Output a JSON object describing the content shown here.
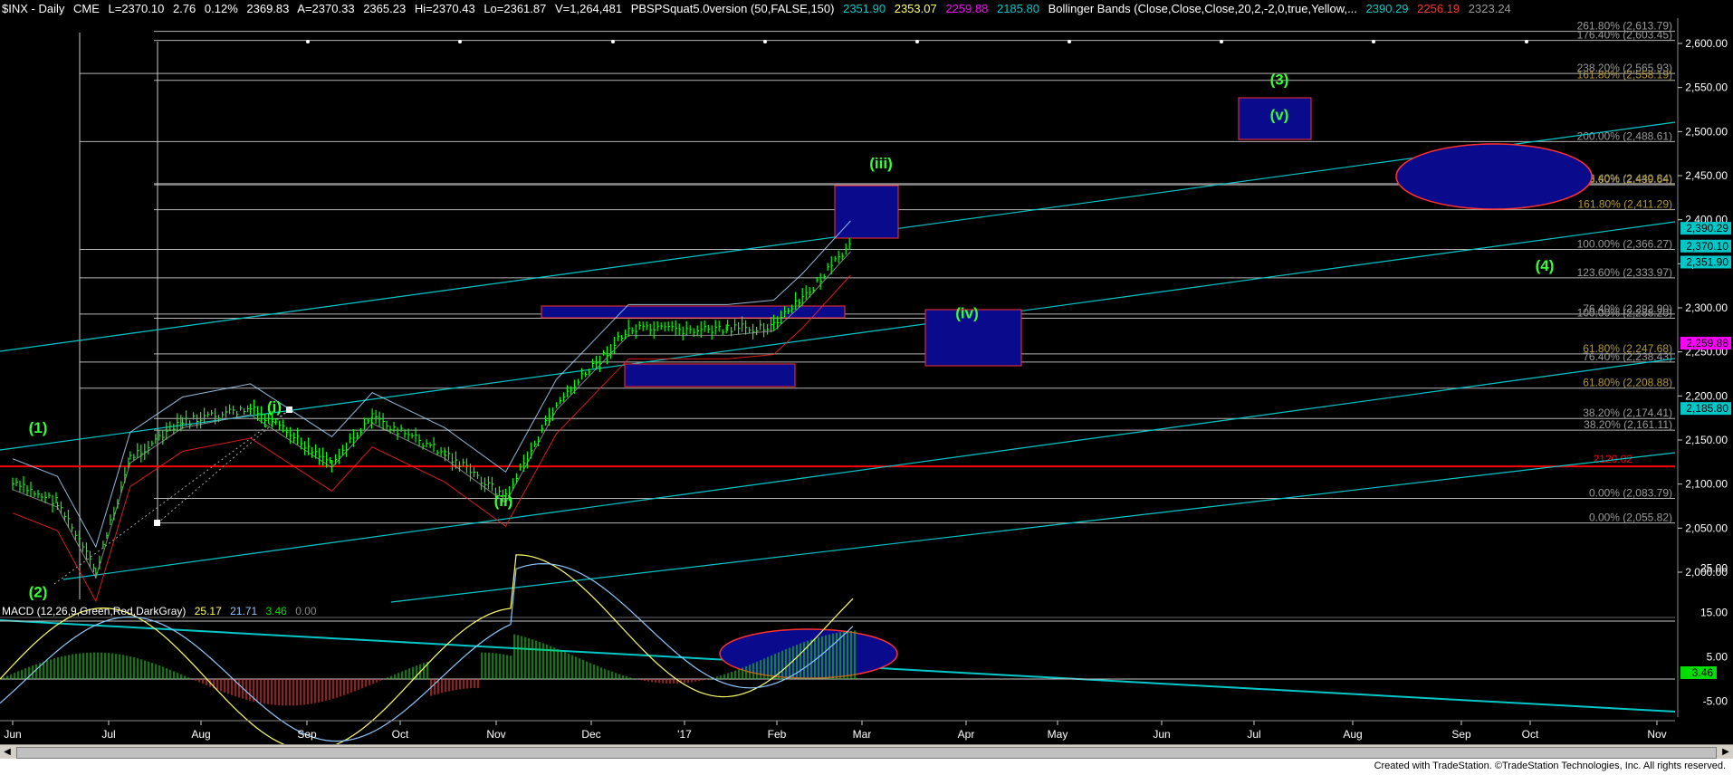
{
  "header": {
    "symbol": "$INX - Daily",
    "exchange": "CME",
    "last": "L=2370.10",
    "change": "2.76",
    "change_pct": "0.12%",
    "bid": "2369.83",
    "ask": "A=2370.33",
    "open": "2365.23",
    "high": "Hi=2370.43",
    "low": "Lo=2361.87",
    "volume": "V=1,264,481",
    "indicator": "PBSPSquat5.0version (50,FALSE,150)",
    "ind_v1": "2351.90",
    "ind_v2": "2353.07",
    "ind_v3": "2259.88",
    "ind_v4": "2185.80",
    "bb_label": "Bollinger Bands (Close,Close,Close,20,2,-2,0,true,Yellow,...",
    "bb_v1": "2390.29",
    "bb_v2": "2256.19",
    "bb_v3": "2323.24"
  },
  "colors": {
    "background": "#000000",
    "price_bar": "#00ff00",
    "channel": "#00c8c8",
    "fib_line": "#c8c8c8",
    "fib_text_gray": "#9a9a9a",
    "fib_text_olive": "#b59a30",
    "red_line": "#ff0000",
    "box_fill": "#0a0a8c",
    "box_stroke": "#ff3030",
    "wave_label": "#33ff33",
    "macd_line": "#ffff66",
    "signal_line": "#8fc8ff",
    "histogram": "#00dd00",
    "histogram_neg": "#ff3030",
    "axis_box_cyan": "#00c8c8",
    "axis_box_magenta": "#ff00ff"
  },
  "price_axis": {
    "ticks": [
      "2,600.00",
      "2,550.00",
      "2,500.00",
      "2,450.00",
      "2,400.00",
      "2,350.00",
      "2,300.00",
      "2,250.00",
      "2,200.00",
      "2,150.00",
      "2,100.00",
      "2,050.00",
      "2,000.00"
    ],
    "highlight_values": [
      {
        "label": "2,390.29",
        "value": 2390.29,
        "color": "#00c8c8"
      },
      {
        "label": "2,370.10",
        "value": 2370.1,
        "color": "#00c8c8"
      },
      {
        "label": "2,351.90",
        "value": 2351.9,
        "color": "#00c8c8"
      },
      {
        "label": "2,259.88",
        "value": 2259.88,
        "color": "#ff00ff"
      },
      {
        "label": "2,185.80",
        "value": 2185.8,
        "color": "#00c8c8"
      }
    ]
  },
  "macd": {
    "label": "MACD (12,26,9,Green,Red,DarkGray)",
    "v1": "25.17",
    "v2": "21.71",
    "v3": "3.46",
    "v4": "0.00",
    "ticks": [
      "25.00",
      "15.00",
      "5.00",
      "-5.00"
    ],
    "current_box": "3.46"
  },
  "time_axis": [
    "Jun",
    "Jul",
    "Aug",
    "Sep",
    "Oct",
    "Nov",
    "Dec",
    "'17",
    "Feb",
    "Mar",
    "Apr",
    "May",
    "Jun",
    "Jul",
    "Aug",
    "Sep",
    "Oct",
    "Nov"
  ],
  "fib_levels": [
    {
      "label": "261.80% (2,613.79)",
      "value": 2613.79,
      "color": "#9a9a9a"
    },
    {
      "label": "176.40% (2,603.45)",
      "value": 2603.45,
      "color": "#9a9a9a"
    },
    {
      "label": "238.20% (2,565.93)",
      "value": 2565.93,
      "color": "#9a9a9a"
    },
    {
      "label": "161.80% (2,558.19)",
      "value": 2558.19,
      "color": "#b59a30"
    },
    {
      "label": "200.00% (2,488.61)",
      "value": 2488.61,
      "color": "#9a9a9a"
    },
    {
      "label": "176.40% (2,440.84)",
      "value": 2440.84,
      "color": "#9a9a9a"
    },
    {
      "label": "123.60% (2,439.64)",
      "value": 2439.64,
      "color": "#b59a30"
    },
    {
      "label": "161.80% (2,411.29)",
      "value": 2411.29,
      "color": "#b59a30"
    },
    {
      "label": "100.00% (2,366.27)",
      "value": 2366.27,
      "color": "#9a9a9a"
    },
    {
      "label": "123.60% (2,333.97)",
      "value": 2333.97,
      "color": "#9a9a9a"
    },
    {
      "label": "76.40% (2,292.90)",
      "value": 2292.9,
      "color": "#9a9a9a"
    },
    {
      "label": "100.00% (2,288.20)",
      "value": 2288.2,
      "color": "#9a9a9a"
    },
    {
      "label": "61.80% (2,247.68)",
      "value": 2247.68,
      "color": "#b59a30"
    },
    {
      "label": "76.40% (2,238.43)",
      "value": 2238.43,
      "color": "#9a9a9a"
    },
    {
      "label": "61.80% (2,208.88)",
      "value": 2208.88,
      "color": "#b59a30"
    },
    {
      "label": "38.20% (2,174.41)",
      "value": 2174.41,
      "color": "#9a9a9a"
    },
    {
      "label": "38.20% (2,161.11)",
      "value": 2161.11,
      "color": "#9a9a9a"
    },
    {
      "label": "0.00% (2,083.79)",
      "value": 2083.79,
      "color": "#9a9a9a"
    },
    {
      "label": "0.00% (2,055.82)",
      "value": 2055.82,
      "color": "#9a9a9a"
    }
  ],
  "red_level": {
    "label": "2120.02",
    "value": 2120.02
  },
  "wave_labels": [
    {
      "text": "(1)",
      "x": "Jun 2016",
      "y": 2158
    },
    {
      "text": "(2)",
      "x": "Jun 2016",
      "y": 1972
    },
    {
      "text": "(i)",
      "x": "Aug 2016",
      "y": 2182
    },
    {
      "text": "(ii)",
      "x": "Nov 2016",
      "y": 2075
    },
    {
      "text": "(iii)",
      "x": "Feb 2017",
      "y": 2458
    },
    {
      "text": "(iv)",
      "x": "Apr 2017",
      "y": 2288
    },
    {
      "text": "(v)",
      "x": "Jul 2017",
      "y": 2513
    },
    {
      "text": "(3)",
      "x": "Jul 2017",
      "y": 2553
    },
    {
      "text": "(4)",
      "x": "Oct 2017",
      "y": 2342
    }
  ],
  "chart_data": {
    "type": "bar",
    "title": "$INX - Daily",
    "x_axis": "date",
    "y_range": [
      1975,
      2640
    ],
    "price_path": [
      {
        "x": "2016-06-01",
        "y": 2100
      },
      {
        "x": "2016-06-15",
        "y": 2080
      },
      {
        "x": "2016-06-27",
        "y": 2000
      },
      {
        "x": "2016-07-08",
        "y": 2130
      },
      {
        "x": "2016-07-25",
        "y": 2170
      },
      {
        "x": "2016-08-15",
        "y": 2185
      },
      {
        "x": "2016-09-09",
        "y": 2125
      },
      {
        "x": "2016-09-22",
        "y": 2175
      },
      {
        "x": "2016-10-15",
        "y": 2135
      },
      {
        "x": "2016-11-04",
        "y": 2085
      },
      {
        "x": "2016-11-20",
        "y": 2190
      },
      {
        "x": "2016-12-13",
        "y": 2275
      },
      {
        "x": "2017-01-15",
        "y": 2275
      },
      {
        "x": "2017-01-30",
        "y": 2280
      },
      {
        "x": "2017-02-10",
        "y": 2310
      },
      {
        "x": "2017-02-27",
        "y": 2370
      }
    ],
    "macd_range": [
      -12,
      30
    ]
  }
}
